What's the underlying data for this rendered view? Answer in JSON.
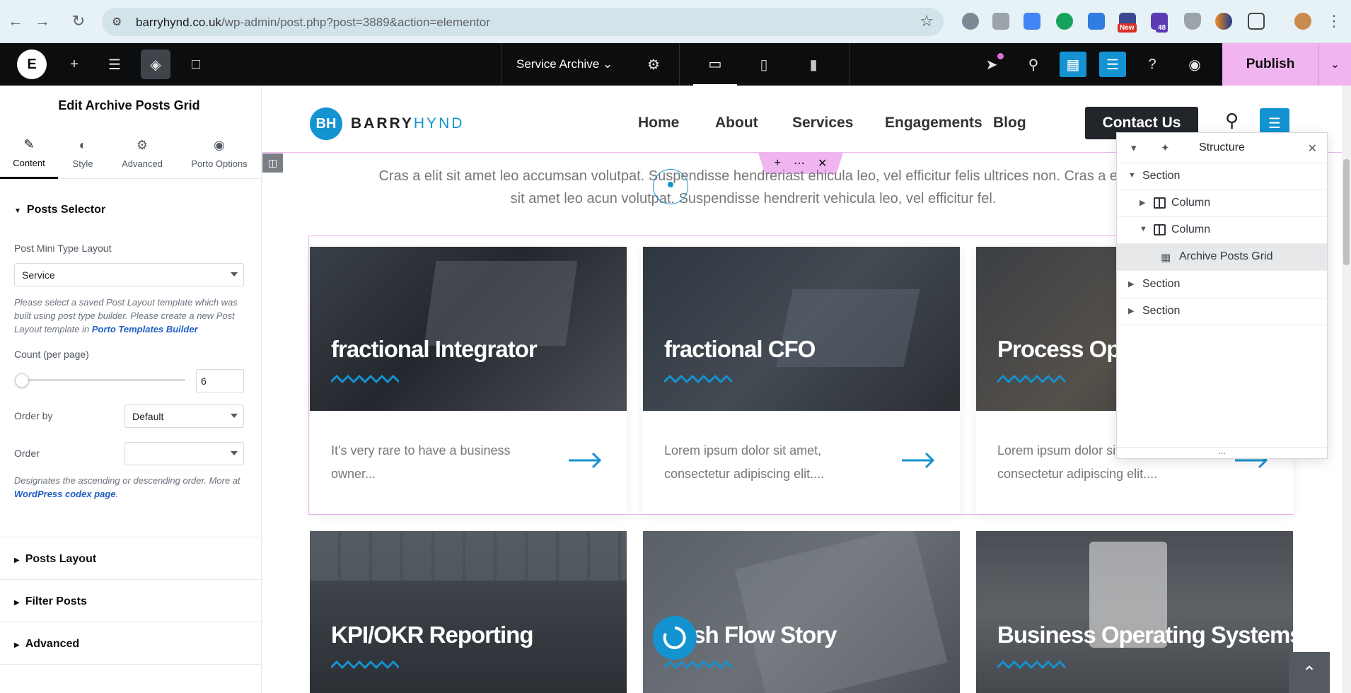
{
  "browser": {
    "url_host": "barryhynd.co.uk",
    "url_path": "/wp-admin/post.php?post=3889&action=elementor",
    "ext_badges": {
      "new": "New",
      "count": "48"
    }
  },
  "editor": {
    "document_title": "Service Archive",
    "publish_label": "Publish"
  },
  "panel": {
    "title": "Edit Archive Posts Grid",
    "tabs": [
      {
        "label": "Content",
        "icon": "pencil-icon"
      },
      {
        "label": "Style",
        "icon": "contrast-icon"
      },
      {
        "label": "Advanced",
        "icon": "gear-icon"
      },
      {
        "label": "Porto Options",
        "icon": "target-icon"
      }
    ],
    "posts_selector": {
      "heading": "Posts Selector",
      "layout_label": "Post Mini Type Layout",
      "layout_value": "Service",
      "layout_help": "Please select a saved Post Layout template which was built using post type builder. Please create a new Post Layout template in",
      "layout_help_link": "Porto Templates Builder",
      "count_label": "Count (per page)",
      "count_value": "6",
      "orderby_label": "Order by",
      "orderby_value": "Default",
      "order_label": "Order",
      "order_value": "",
      "order_help": "Designates the ascending or descending order. More at",
      "order_help_link": "WordPress codex page",
      "order_help_end": "."
    },
    "sections": [
      "Posts Layout",
      "Filter Posts",
      "Advanced"
    ]
  },
  "site": {
    "logo_mark": "BH",
    "logo_word_1": "BARRY",
    "logo_word_2": "HYND",
    "nav": [
      "Home",
      "About",
      "Services",
      "Engagements",
      "Blog"
    ],
    "contact_label": "Contact Us",
    "intro_line_1": "Cras a elit sit amet leo accumsan volutpat. Suspendisse hendreriast ehicula leo, vel efficitur felis ultrices non. Cras a elit",
    "intro_line_2": "sit amet leo acun volutpat. Suspendisse hendrerit vehicula leo, vel efficitur fel.",
    "cards": [
      {
        "title": "fractional Integrator",
        "excerpt": "It's very rare to have a business owner..."
      },
      {
        "title": "fractional CFO",
        "excerpt": "Lorem ipsum dolor sit amet, consectetur adipiscing elit...."
      },
      {
        "title": "Process Optimization",
        "excerpt": "Lorem ipsum dolor sit amet, consectetur adipiscing elit...."
      },
      {
        "title": "KPI/OKR Reporting"
      },
      {
        "title": "Cash Flow Story"
      },
      {
        "title": "Business Operating Systems"
      }
    ]
  },
  "structure": {
    "title": "Structure",
    "rows": [
      {
        "label": "Section",
        "level": 0,
        "expanded": true
      },
      {
        "label": "Column",
        "level": 1,
        "expanded": false
      },
      {
        "label": "Column",
        "level": 1,
        "expanded": true
      },
      {
        "label": "Archive Posts Grid",
        "level": 2,
        "selected": true
      },
      {
        "label": "Section",
        "level": 0,
        "expanded": false
      },
      {
        "label": "Section",
        "level": 0,
        "expanded": false
      }
    ],
    "footer": "..."
  },
  "colors": {
    "accent_blue": "#1493d1",
    "publish_pink": "#f0b5f0",
    "editor_dark": "#0c0d0e"
  }
}
